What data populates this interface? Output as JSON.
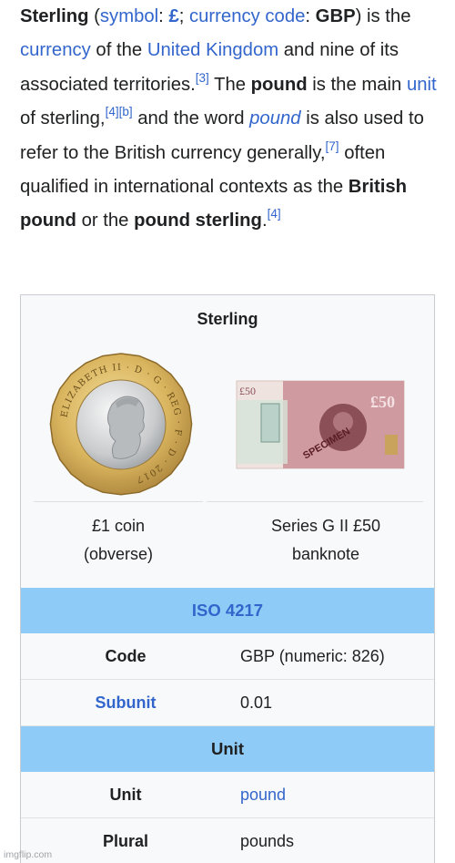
{
  "article": {
    "s1_title": "Sterling",
    "s1_symbol_link": "symbol",
    "s1_symbol_value": "£",
    "s1_code_link": "currency code",
    "s1_code_value": "GBP",
    "s1_mid": "is the",
    "s1_currency_link": "currency",
    "s1_of": "of the",
    "s1_uk_link": "United Kingdom",
    "s1_tail": "and nine of its associated territories.",
    "ref_3": "[3]",
    "s2_lead": "The",
    "s2_pound": "pound",
    "s2_mid": "is the main",
    "s2_unit_link": "unit",
    "s2_of": "of sterling,",
    "ref_4": "[4]",
    "ref_b": "[b]",
    "s2_and": "and the word",
    "s2_pound_link": "pound",
    "s2_tail": "is also used to refer to the British currency generally,",
    "ref_7": "[7]",
    "s3": "often qualified in international contexts as the",
    "s3_bp": "British pound",
    "s3_or": "or the",
    "s3_ps": "pound sterling",
    "s3_end": ".",
    "ref_4b": "[4]"
  },
  "infobox": {
    "title": "Sterling",
    "coin_text": "ELIZABETH II · D · G · REG · F · D · 2017",
    "coin_caption_1": "£1 coin",
    "coin_caption_2": "(obverse)",
    "note_caption_1": "Series G II £50",
    "note_caption_2": "banknote",
    "note_denomination": "£50",
    "note_specimen": "SPECIMEN",
    "section_iso": "ISO 4217",
    "code_label": "Code",
    "code_value": "GBP (numeric: 826)",
    "subunit_label": "Subunit",
    "subunit_value": "0.01",
    "section_unit": "Unit",
    "unit_label": "Unit",
    "unit_value": "pound",
    "plural_label": "Plural",
    "plural_value": "pounds"
  },
  "watermark": "imgflip.com",
  "colors": {
    "link": "#3366cc",
    "band": "#8fcbf7",
    "infobox_bg": "#f8f9fa",
    "text": "#202122"
  }
}
